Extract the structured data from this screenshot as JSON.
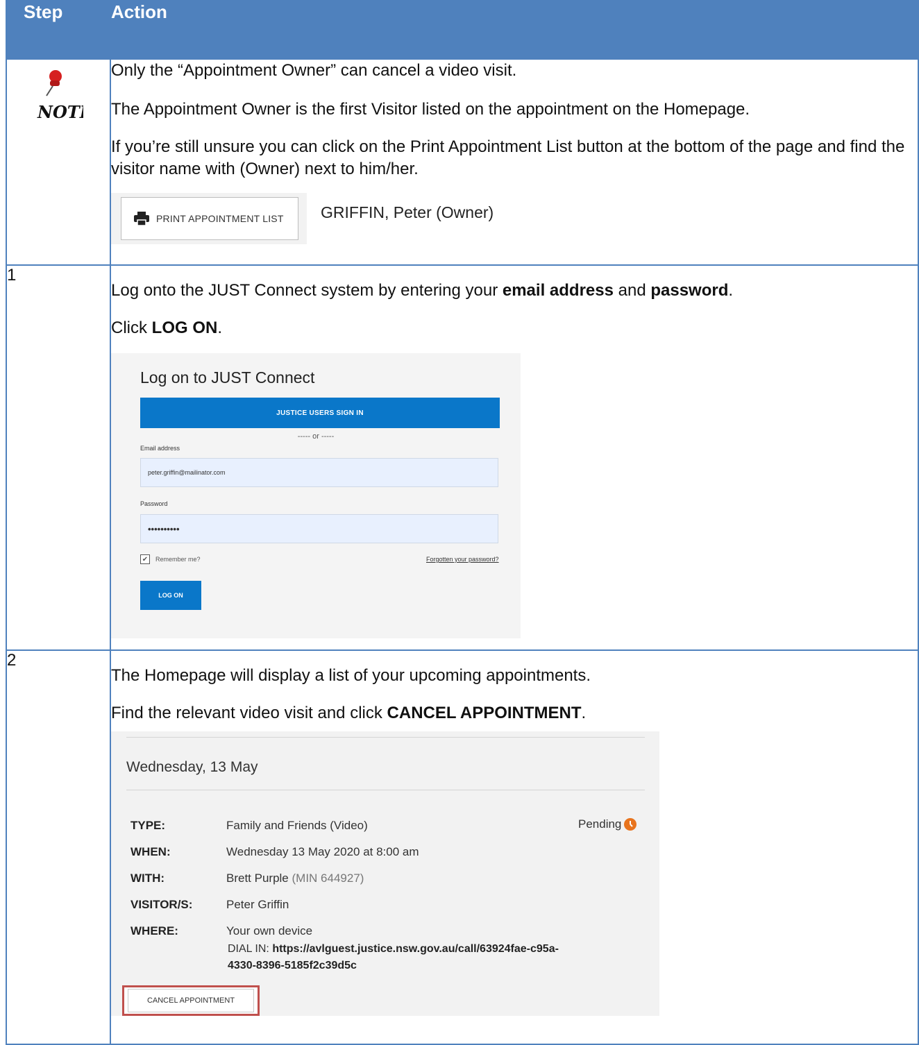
{
  "header": {
    "step": "Step",
    "action": "Action"
  },
  "note": {
    "icon_label": "NOTE",
    "line1": "Only the “Appointment Owner” can cancel a video visit.",
    "line2": "The Appointment Owner is the first Visitor listed on the appointment on the Homepage.",
    "line3": "If you’re still unsure you can click on the Print Appointment List button at the bottom of the page and find the visitor name with (Owner) next to him/her.",
    "print_button": "PRINT APPOINTMENT LIST",
    "owner_name": "GRIFFIN, Peter (Owner)"
  },
  "step1": {
    "number": "1",
    "text_a": "Log onto the JUST Connect system by entering your ",
    "bold_email": "email address",
    "text_and": " and ",
    "bold_password": "password",
    "text_end": ".",
    "click_prefix": "Click ",
    "click_bold": "LOG ON",
    "click_end": ".",
    "login": {
      "title": "Log on to JUST Connect",
      "justice_button": "JUSTICE USERS SIGN IN",
      "or_text": "----- or -----",
      "email_label": "Email address",
      "email_value": "peter.griffin@mailinator.com",
      "password_label": "Password",
      "password_value": "••••••••••",
      "remember_label": "Remember me?",
      "forgot_link": "Forgotten your password?",
      "logon_button": "LOG ON"
    }
  },
  "step2": {
    "number": "2",
    "line1": "The Homepage will display a list of your upcoming appointments.",
    "line2_prefix": "Find the relevant video visit and click ",
    "line2_bold": "CANCEL APPOINTMENT",
    "line2_end": ".",
    "appointment": {
      "date": "Wednesday, 13 May",
      "status": "Pending",
      "type_label": "TYPE:",
      "type_value": "Family and Friends (Video)",
      "when_label": "WHEN:",
      "when_value": "Wednesday 13 May 2020 at 8:00 am",
      "with_label": "WITH:",
      "with_value": "Brett Purple",
      "with_min": "(MIN 644927)",
      "visitors_label": "VISITOR/S:",
      "visitors_value": "Peter Griffin",
      "where_label": "WHERE:",
      "where_value": "Your own device",
      "dial_prefix": "DIAL IN: ",
      "dial_url_1": "https://avlguest.justice.nsw.gov.au/call/63924fae-c95a-",
      "dial_url_2": "4330-8396-5185f2c39d5c",
      "cancel_button": "CANCEL APPOINTMENT"
    }
  }
}
